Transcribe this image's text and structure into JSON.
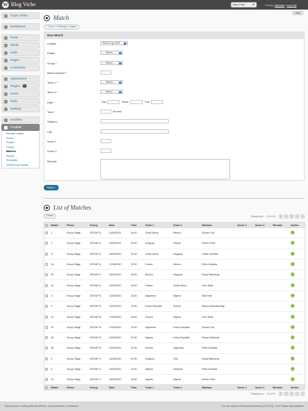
{
  "topbar": {
    "site_title": "Blog Viche",
    "new_post_label": "New Post",
    "howdy_prefix": "Howdy,",
    "username": "nighorta",
    "logout": "Log Out"
  },
  "help_label": "Help",
  "sidebar": {
    "items": [
      {
        "label": "Super Admin"
      },
      {
        "label": "Dashboard"
      },
      {
        "label": "Posts"
      },
      {
        "label": "Media"
      },
      {
        "label": "Links"
      },
      {
        "label": "Pages"
      },
      {
        "label": "Comments"
      },
      {
        "label": "Appearance"
      },
      {
        "label": "Plugins",
        "badge": "1"
      },
      {
        "label": "Users"
      },
      {
        "label": "Tools"
      },
      {
        "label": "Settings"
      },
      {
        "label": "IvGallery"
      },
      {
        "label": "Football"
      }
    ],
    "football_submenu": [
      "Manage League",
      "Teams",
      "Phases",
      "Groups",
      "Matches",
      "Results",
      "Templates",
      "Uninstall wp-football"
    ]
  },
  "match_form": {
    "title": "Match",
    "back_link": "« Back to Manage League",
    "box_title": "New Match",
    "fields": {
      "league": {
        "label": "League",
        "value": "World Cup 2010"
      },
      "phase": {
        "label": "Phase",
        "value": "--- Select ---"
      },
      "group": {
        "label": "Group *",
        "value": "--- Select ---"
      },
      "match_number": {
        "label": "Match Number *"
      },
      "team1": {
        "label": "Team 1 *",
        "value": "--- Select ---"
      },
      "team2": {
        "label": "Team 2 *",
        "value": "--- Select ---"
      },
      "date": {
        "label": "Date *",
        "day": "Day",
        "month": "Month",
        "year": "Year"
      },
      "time": {
        "label": "Time *",
        "suffix": "(hh:mm)"
      },
      "stadium": {
        "label": "Stadium"
      },
      "city": {
        "label": "City"
      },
      "score1": {
        "label": "Score 1"
      },
      "score2": {
        "label": "Score 2"
      },
      "remark": {
        "label": "Remark"
      }
    },
    "save_label": "Save »"
  },
  "list": {
    "title": "List of Matches",
    "delete_label": "Delete",
    "displaying": "Displaying 1 - 15 of 64",
    "pages": [
      "1",
      "2",
      "3",
      "4",
      "»"
    ],
    "current_page": "1",
    "columns": [
      "Match",
      "Phase",
      "Group",
      "Date",
      "Time",
      "Team 1",
      "Team 2",
      "Stadium",
      "Score 1",
      "Score 2",
      "Remark",
      "Action"
    ],
    "rows": [
      [
        "1",
        "Group Stage",
        "GROUP A",
        "11/06/2010",
        "16:00",
        "South Africa",
        "Mexico",
        "Soccer City"
      ],
      [
        "2",
        "Group Stage",
        "GROUP A",
        "11/06/2010",
        "20:30",
        "Uruguay",
        "France",
        "Green Point"
      ],
      [
        "17",
        "Group Stage",
        "GROUP A",
        "16/06/2010",
        "20:30",
        "South Africa",
        "Uruguay",
        "Loftus Versfeld"
      ],
      [
        "18",
        "Group Stage",
        "GROUP A",
        "17/06/2010",
        "20:30",
        "France",
        "Mexico",
        "Peter Mokaba"
      ],
      [
        "33",
        "Group Stage",
        "GROUP A",
        "22/06/2010",
        "16:00",
        "Mexico",
        "Uruguay",
        "Royal Bafokeng"
      ],
      [
        "34",
        "Group Stage",
        "GROUP A",
        "22/06/2010",
        "16:00",
        "France",
        "South Africa",
        "Free State"
      ],
      [
        "3",
        "Group Stage",
        "GROUP B",
        "12/06/2010",
        "16:00",
        "Argentina",
        "Nigeria",
        "Ellis Park"
      ],
      [
        "4",
        "Group Stage",
        "GROUP B",
        "12/06/2010",
        "13:30",
        "Korea Republic",
        "Greece",
        "Nelson Mandela Bay"
      ],
      [
        "19",
        "Group Stage",
        "GROUP B",
        "17/06/2010",
        "16:00",
        "Greece",
        "Nigeria",
        "Free State"
      ],
      [
        "20",
        "Group Stage",
        "GROUP B",
        "17/06/2010",
        "13:30",
        "Argentina",
        "Korea Republic",
        "Soccer City"
      ],
      [
        "35",
        "Group Stage",
        "GROUP B",
        "22/06/2010",
        "20:30",
        "Nigeria",
        "Korea Republic",
        "Moses Mabhida"
      ],
      [
        "36",
        "Group Stage",
        "GROUP B",
        "22/06/2010",
        "20:30",
        "Greece",
        "Argentina",
        "Peter Mokaba"
      ],
      [
        "5",
        "Group Stage",
        "GROUP C",
        "12/06/2010",
        "20:30",
        "England",
        "USA",
        "Royal Bafokeng"
      ],
      [
        "6",
        "Group Stage",
        "GROUP C",
        "13/06/2010",
        "13:30",
        "Algeria",
        "Slovenia",
        "Peter Mokaba"
      ],
      [
        "23",
        "Group Stage",
        "GROUP C",
        "18/06/2010",
        "16:00",
        "Algeria",
        "Algeria",
        "Green Point"
      ]
    ]
  },
  "footer": {
    "left_text": "Thank you for creating with WordPress. | Documentation | Feedback",
    "right_text": "You are using a development version (3.0-RC3). Cool! Please stay updated."
  }
}
